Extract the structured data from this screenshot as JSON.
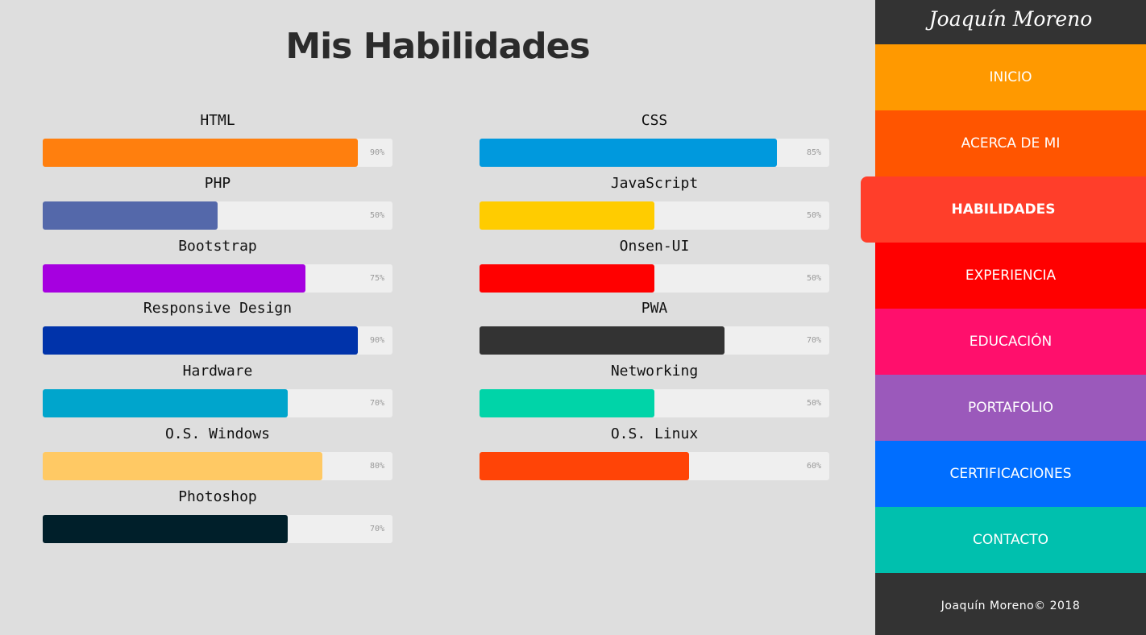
{
  "header": {
    "title": "Mis Habilidades"
  },
  "skills": [
    {
      "name": "HTML",
      "percent": 90,
      "label": "90%",
      "color": "#ff7f0e"
    },
    {
      "name": "CSS",
      "percent": 85,
      "label": "85%",
      "color": "#0099dd"
    },
    {
      "name": "PHP",
      "percent": 50,
      "label": "50%",
      "color": "#5468aa"
    },
    {
      "name": "JavaScript",
      "percent": 50,
      "label": "50%",
      "color": "#ffcc00"
    },
    {
      "name": "Bootstrap",
      "percent": 75,
      "label": "75%",
      "color": "#a600e0"
    },
    {
      "name": "Onsen-UI",
      "percent": 50,
      "label": "50%",
      "color": "#ff0000"
    },
    {
      "name": "Responsive Design",
      "percent": 90,
      "label": "90%",
      "color": "#0033aa"
    },
    {
      "name": "PWA",
      "percent": 70,
      "label": "70%",
      "color": "#333333"
    },
    {
      "name": "Hardware",
      "percent": 70,
      "label": "70%",
      "color": "#00a5cc"
    },
    {
      "name": "Networking",
      "percent": 50,
      "label": "50%",
      "color": "#00d4a8"
    },
    {
      "name": "O.S. Windows",
      "percent": 80,
      "label": "80%",
      "color": "#ffc964"
    },
    {
      "name": "O.S. Linux",
      "percent": 60,
      "label": "60%",
      "color": "#ff4407"
    },
    {
      "name": "Photoshop",
      "percent": 70,
      "label": "70%",
      "color": "#001f2a"
    }
  ],
  "sidebar": {
    "brand": "Joaquín Moreno",
    "items": [
      {
        "label": "INICIO",
        "color": "#ff9900",
        "active": false
      },
      {
        "label": "ACERCA DE MI",
        "color": "#ff5500",
        "active": false
      },
      {
        "label": "HABILIDADES",
        "color": "#ff3e2a",
        "active": true
      },
      {
        "label": "EXPERIENCIA",
        "color": "#ff0000",
        "active": false
      },
      {
        "label": "EDUCACIÓN",
        "color": "#ff0f6c",
        "active": false
      },
      {
        "label": "PORTAFOLIO",
        "color": "#9b59bb",
        "active": false
      },
      {
        "label": "CERTIFICACIONES",
        "color": "#006eff",
        "active": false
      },
      {
        "label": "CONTACTO",
        "color": "#00c0ae",
        "active": false
      }
    ],
    "footer": "Joaquín Moreno© 2018"
  }
}
